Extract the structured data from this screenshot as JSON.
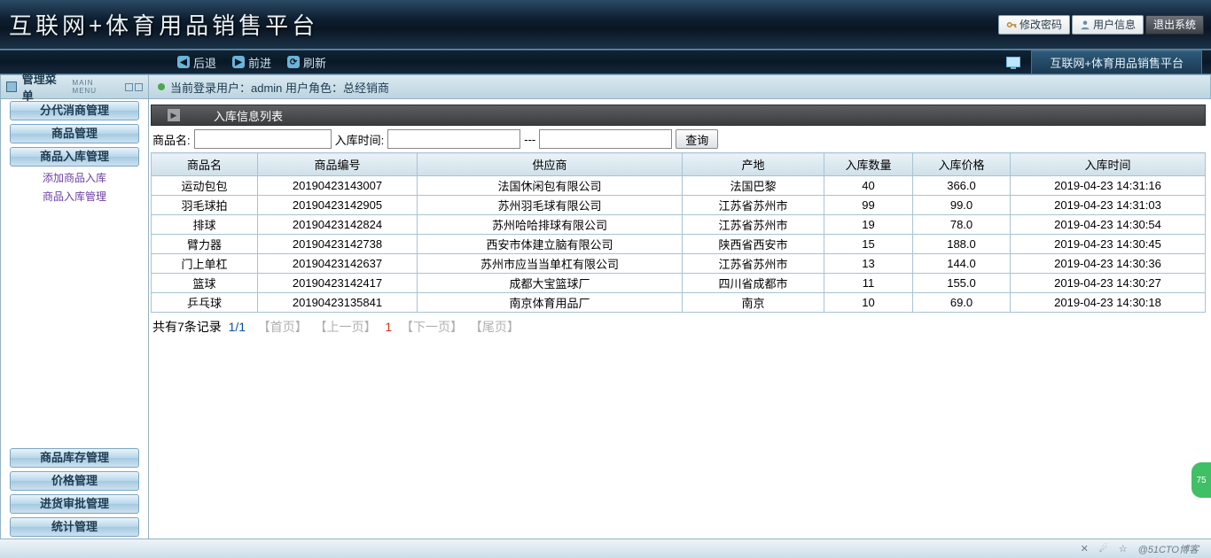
{
  "app": {
    "title": "互联网+体育用品销售平台"
  },
  "top_buttons": {
    "change_pw": "修改密码",
    "user_info": "用户信息",
    "logout": "退出系统"
  },
  "nav": {
    "back": "后退",
    "forward": "前进",
    "refresh": "刷新",
    "tab_title": "互联网+体育用品销售平台"
  },
  "sidebar": {
    "header": "管理菜单",
    "header_sub": "MAIN MENU",
    "items": [
      "分代消商管理",
      "商品管理",
      "商品入库管理"
    ],
    "subitems": [
      "添加商品入库",
      "商品入库管理"
    ],
    "bottom_items": [
      "商品库存管理",
      "价格管理",
      "进货审批管理",
      "统计管理"
    ]
  },
  "mainhead": {
    "text": "当前登录用户：admin 用户角色：总经销商"
  },
  "panel": {
    "title": "入库信息列表"
  },
  "filters": {
    "name_label": "商品名:",
    "time_label": "入库时间:",
    "sep": "---",
    "query_btn": "查询"
  },
  "table": {
    "headers": [
      "商品名",
      "商品编号",
      "供应商",
      "产地",
      "入库数量",
      "入库价格",
      "入库时间"
    ],
    "rows": [
      [
        "运动包包",
        "20190423143007",
        "法国休闲包有限公司",
        "法国巴黎",
        "40",
        "366.0",
        "2019-04-23 14:31:16"
      ],
      [
        "羽毛球拍",
        "20190423142905",
        "苏州羽毛球有限公司",
        "江苏省苏州市",
        "99",
        "99.0",
        "2019-04-23 14:31:03"
      ],
      [
        "排球",
        "20190423142824",
        "苏州哈哈排球有限公司",
        "江苏省苏州市",
        "19",
        "78.0",
        "2019-04-23 14:30:54"
      ],
      [
        "臂力器",
        "20190423142738",
        "西安市体建立脑有限公司",
        "陕西省西安市",
        "15",
        "188.0",
        "2019-04-23 14:30:45"
      ],
      [
        "门上单杠",
        "20190423142637",
        "苏州市应当当单杠有限公司",
        "江苏省苏州市",
        "13",
        "144.0",
        "2019-04-23 14:30:36"
      ],
      [
        "篮球",
        "20190423142417",
        "成都大宝篮球厂",
        "四川省成都市",
        "11",
        "155.0",
        "2019-04-23 14:30:27"
      ],
      [
        "乒乓球",
        "20190423135841",
        "南京体育用品厂",
        "南京",
        "10",
        "69.0",
        "2019-04-23 14:30:18"
      ]
    ]
  },
  "pager": {
    "total": "共有7条记录",
    "page": "1/1",
    "first": "【首页】",
    "prev": "【上一页】",
    "current": "1",
    "next": "【下一页】",
    "last": "【尾页】"
  },
  "status": {
    "watermark": "@51CTO博客"
  },
  "badge": {
    "num": "75"
  }
}
